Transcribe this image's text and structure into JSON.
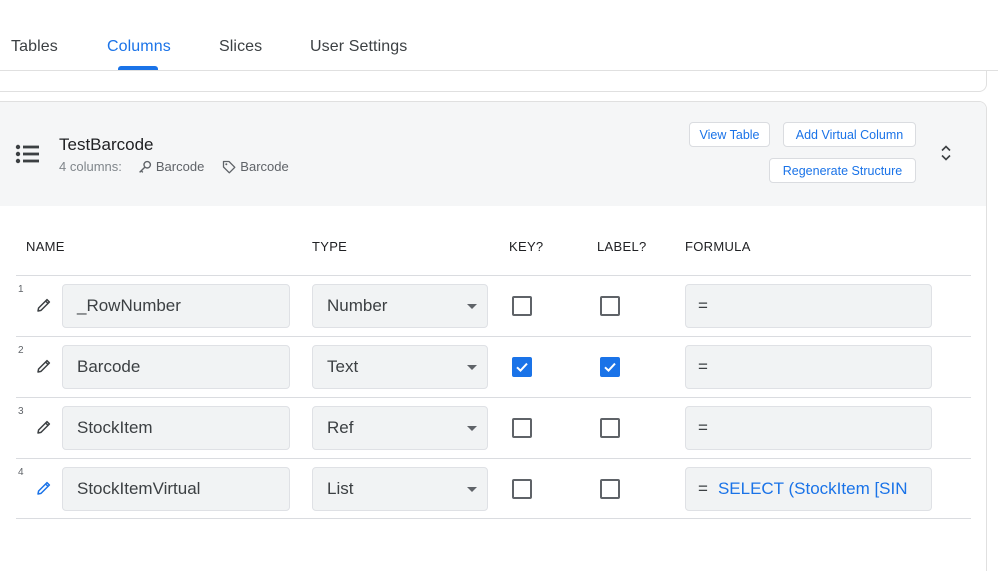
{
  "tabs": [
    {
      "label": "Tables",
      "active": false
    },
    {
      "label": "Columns",
      "active": true
    },
    {
      "label": "Slices",
      "active": false
    },
    {
      "label": "User Settings",
      "active": false
    }
  ],
  "table": {
    "name": "TestBarcode",
    "columns_count": "4 columns:",
    "key_column": "Barcode",
    "label_column": "Barcode",
    "buttons": {
      "view_table": "View Table",
      "add_virtual_column": "Add Virtual Column",
      "regenerate_structure": "Regenerate Structure"
    }
  },
  "column_headers": {
    "name": "NAME",
    "type": "TYPE",
    "key": "KEY?",
    "label": "LABEL?",
    "formula": "FORMULA"
  },
  "rows": [
    {
      "num": "1",
      "name": "_RowNumber",
      "type": "Number",
      "key": false,
      "label": false,
      "formula_eq": "=",
      "formula": "",
      "virtual": false
    },
    {
      "num": "2",
      "name": "Barcode",
      "type": "Text",
      "key": true,
      "label": true,
      "formula_eq": "=",
      "formula": "",
      "virtual": false
    },
    {
      "num": "3",
      "name": "StockItem",
      "type": "Ref",
      "key": false,
      "label": false,
      "formula_eq": "=",
      "formula": "",
      "virtual": false
    },
    {
      "num": "4",
      "name": "StockItemVirtual",
      "type": "List",
      "key": false,
      "label": false,
      "formula_eq": "=",
      "formula": "SELECT (StockItem [SIN",
      "virtual": true
    }
  ],
  "icons": {
    "table": "list-icon",
    "key": "key-icon",
    "label": "tag-icon",
    "edit": "pencil-icon",
    "expand": "unfold-icon",
    "dropdown": "caret-down-icon",
    "check": "check-icon"
  },
  "colors": {
    "accent": "#1a73e8",
    "header_bg": "#f5f6f7",
    "field_bg": "#f1f3f4"
  }
}
